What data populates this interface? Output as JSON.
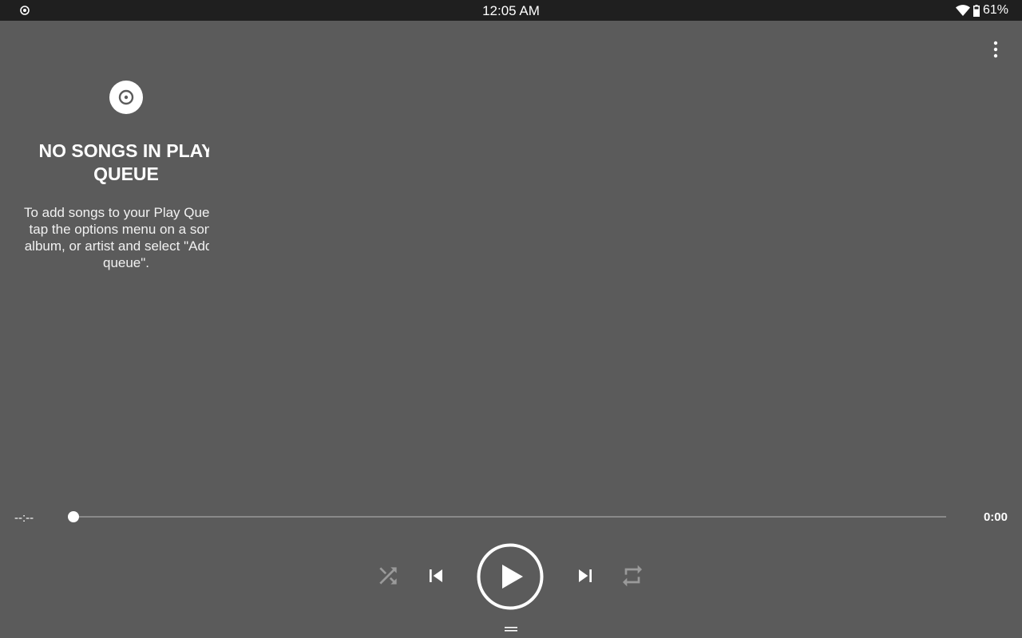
{
  "status_bar": {
    "time": "12:05 AM",
    "battery": "61%",
    "left_icon": "media-playing-icon",
    "wifi_icon": "wifi-icon",
    "battery_icon": "battery-icon"
  },
  "toolbar": {
    "overflow_icon": "more-vert-icon"
  },
  "empty_state": {
    "icon": "album-icon",
    "title": "NO SONGS IN PLAY QUEUE",
    "body": "To add songs to your Play Queue, tap the options menu on a song, album, or artist and select \"Add to queue\"."
  },
  "player": {
    "elapsed": "--:--",
    "total": "0:00",
    "progress": 0,
    "controls": {
      "shuffle": "shuffle-icon",
      "previous": "skip-previous-icon",
      "play": "play-icon",
      "next": "skip-next-icon",
      "repeat": "repeat-icon",
      "drag_handle": "drag-handle-icon"
    }
  },
  "colors": {
    "background": "#5b5b5b",
    "status_bar": "#1f1f1f",
    "foreground": "#ffffff",
    "disabled_icon": "#9a9a9a"
  }
}
